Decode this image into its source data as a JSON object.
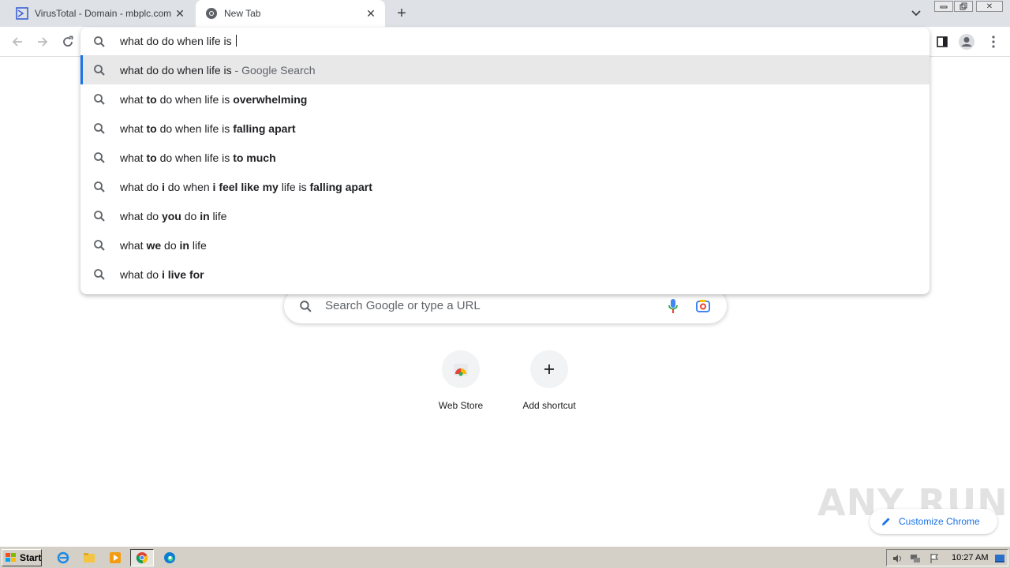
{
  "tabs": [
    {
      "title": "VirusTotal - Domain - mbplc.com",
      "active": false
    },
    {
      "title": "New Tab",
      "active": true
    }
  ],
  "omnibox": {
    "typed": "what do do when life is ",
    "suggestions": [
      {
        "parts": [
          {
            "t": "what do do when life is",
            "b": false
          },
          {
            "t": " - Google Search",
            "b": false,
            "suffix": true
          }
        ],
        "selected": true
      },
      {
        "parts": [
          {
            "t": "what ",
            "b": false
          },
          {
            "t": "to",
            "b": true
          },
          {
            "t": " do when life is ",
            "b": false
          },
          {
            "t": "overwhelming",
            "b": true
          }
        ]
      },
      {
        "parts": [
          {
            "t": "what ",
            "b": false
          },
          {
            "t": "to",
            "b": true
          },
          {
            "t": " do when life is ",
            "b": false
          },
          {
            "t": "falling apart",
            "b": true
          }
        ]
      },
      {
        "parts": [
          {
            "t": "what ",
            "b": false
          },
          {
            "t": "to",
            "b": true
          },
          {
            "t": " do when life is ",
            "b": false
          },
          {
            "t": "to much",
            "b": true
          }
        ]
      },
      {
        "parts": [
          {
            "t": "what do ",
            "b": false
          },
          {
            "t": "i",
            "b": true
          },
          {
            "t": " do when ",
            "b": false
          },
          {
            "t": "i feel like my",
            "b": true
          },
          {
            "t": " life is ",
            "b": false
          },
          {
            "t": "falling apart",
            "b": true
          }
        ]
      },
      {
        "parts": [
          {
            "t": "what do ",
            "b": false
          },
          {
            "t": "you",
            "b": true
          },
          {
            "t": " do ",
            "b": false
          },
          {
            "t": "in",
            "b": true
          },
          {
            "t": " life",
            "b": false
          }
        ]
      },
      {
        "parts": [
          {
            "t": "what ",
            "b": false
          },
          {
            "t": "we",
            "b": true
          },
          {
            "t": " do ",
            "b": false
          },
          {
            "t": "in",
            "b": true
          },
          {
            "t": " life",
            "b": false
          }
        ]
      },
      {
        "parts": [
          {
            "t": "what do ",
            "b": false
          },
          {
            "t": "i live for",
            "b": true
          }
        ]
      }
    ]
  },
  "ntp": {
    "search_placeholder": "Search Google or type a URL",
    "shortcuts": [
      {
        "label": "Web Store"
      },
      {
        "label": "Add shortcut"
      }
    ],
    "customize_label": "Customize Chrome"
  },
  "watermark": "ANY RUN",
  "taskbar": {
    "start_label": "Start",
    "clock": "10:27 AM"
  },
  "colors": {
    "accent": "#1a73e8",
    "tabstrip": "#dee1e6",
    "taskbar": "#d4d0c8"
  }
}
